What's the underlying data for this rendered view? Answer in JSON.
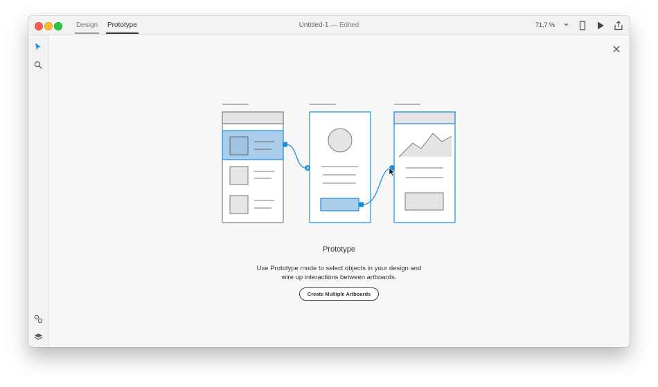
{
  "titlebar": {
    "tabs": [
      {
        "label": "Design"
      },
      {
        "label": "Prototype"
      }
    ],
    "doc_name": "Untitled-1",
    "doc_separator": "—",
    "doc_status": "Edited",
    "zoom": "71,7 %",
    "icons": [
      "device-preview-icon",
      "play-icon",
      "share-icon"
    ]
  },
  "sidebar": {
    "icons": [
      "select-arrow-icon",
      "search-icon",
      "symbols-icon",
      "layers-icon"
    ]
  },
  "empty_state": {
    "heading": "Prototype",
    "desc_line1": "Use Prototype mode to select objects in your design and",
    "desc_line2": "wire up interactions between artboards.",
    "button": "Create Multiple Artboards"
  },
  "colors": {
    "accent": "#1a8ed8",
    "highlight_fill": "#a9cdeb"
  }
}
